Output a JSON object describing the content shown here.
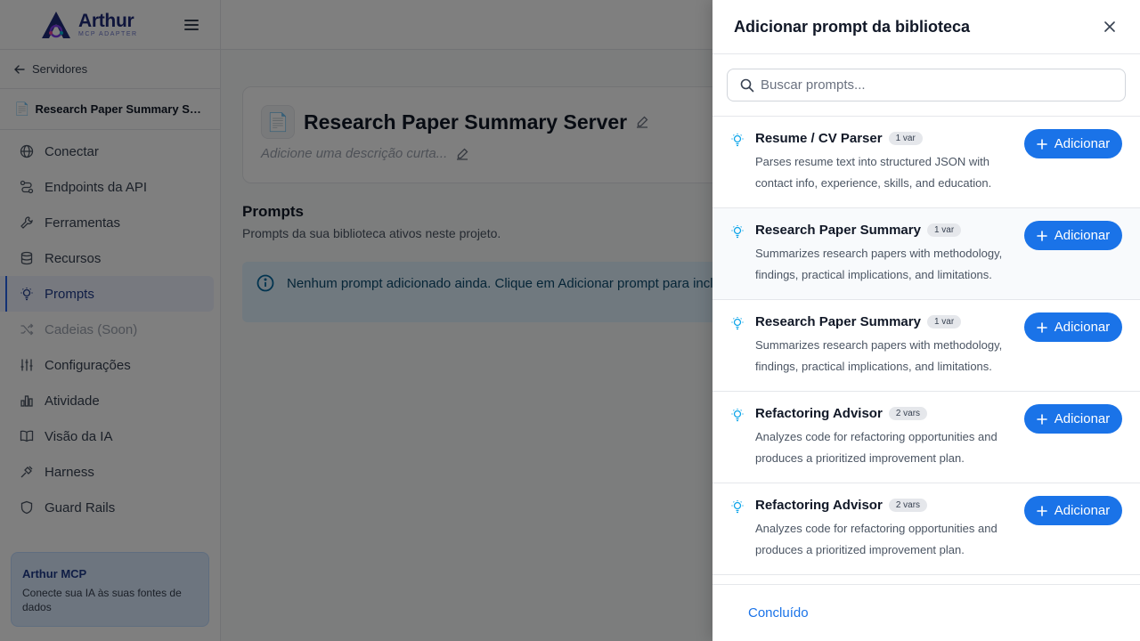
{
  "sidebar": {
    "logo": {
      "title": "Arthur",
      "subtitle": "MCP ADAPTER"
    },
    "back_label": "Servidores",
    "server_name": "Research Paper Summary Server",
    "nav": [
      {
        "label": "Conectar",
        "icon": "globe-icon"
      },
      {
        "label": "Endpoints da API",
        "icon": "route-icon"
      },
      {
        "label": "Ferramentas",
        "icon": "wrench-icon"
      },
      {
        "label": "Recursos",
        "icon": "database-icon"
      },
      {
        "label": "Prompts",
        "icon": "lightbulb-icon",
        "active": true
      },
      {
        "label": "Cadeias (Soon)",
        "icon": "shuffle-icon",
        "disabled": true
      },
      {
        "label": "Configurações",
        "icon": "sliders-icon"
      },
      {
        "label": "Atividade",
        "icon": "bar-chart-icon"
      },
      {
        "label": "Visão da IA",
        "icon": "book-icon"
      },
      {
        "label": "Harness",
        "icon": "harness-icon"
      },
      {
        "label": "Guard Rails",
        "icon": "shield-icon"
      }
    ],
    "promo": {
      "title": "Arthur MCP",
      "description": "Conecte sua IA às suas fontes de dados"
    }
  },
  "main": {
    "header": {
      "title": "Research Paper Summary Server",
      "description_placeholder": "Adicione uma descrição curta..."
    },
    "section_title": "Prompts",
    "section_subtitle": "Prompts da sua biblioteca ativos neste projeto.",
    "info_text": "Nenhum prompt adicionado ainda. Clique em Adicionar prompt para incluir novos."
  },
  "drawer": {
    "title": "Adicionar prompt da biblioteca",
    "search_placeholder": "Buscar prompts...",
    "add_label": "Adicionar",
    "done_label": "Concluído",
    "items": [
      {
        "name": "Resume / CV Parser",
        "vars": "1 var",
        "description": "Parses resume text into structured JSON with contact info, experience, skills, and education."
      },
      {
        "name": "Research Paper Summary",
        "vars": "1 var",
        "description": "Summarizes research papers with methodology, findings, practical implications, and limitations."
      },
      {
        "name": "Research Paper Summary",
        "vars": "1 var",
        "description": "Summarizes research papers with methodology, findings, practical implications, and limitations."
      },
      {
        "name": "Refactoring Advisor",
        "vars": "2 vars",
        "description": "Analyzes code for refactoring opportunities and produces a prioritized improvement plan."
      },
      {
        "name": "Refactoring Advisor",
        "vars": "2 vars",
        "description": "Analyzes code for refactoring opportunities and produces a prioritized improvement plan."
      }
    ]
  }
}
